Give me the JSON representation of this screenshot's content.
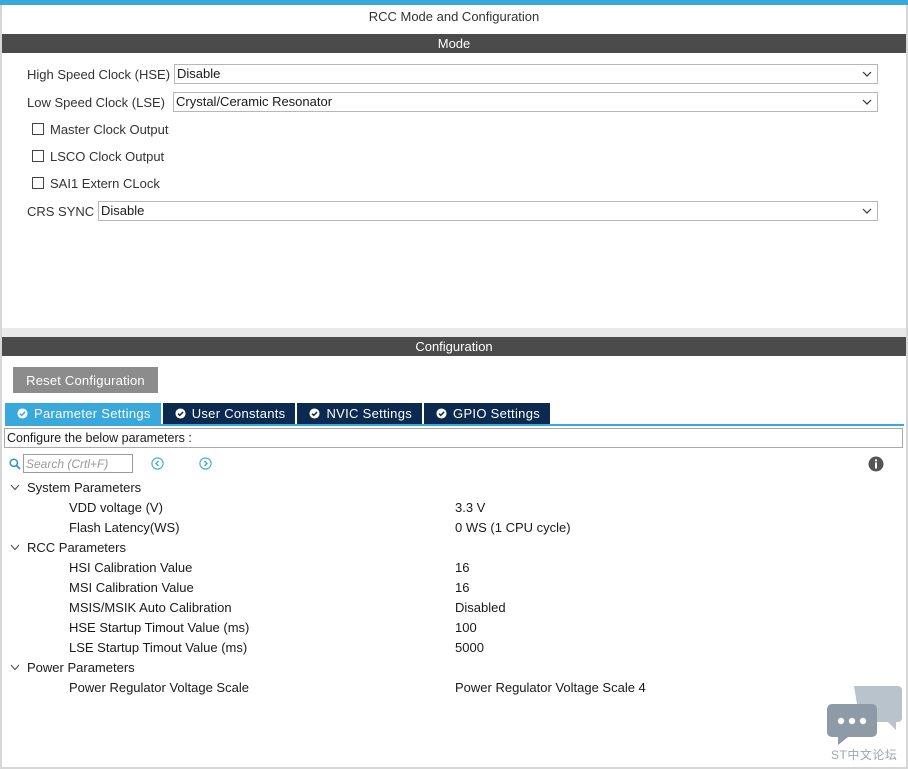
{
  "window": {
    "title": "RCC Mode and Configuration"
  },
  "mode": {
    "header": "Mode",
    "hse": {
      "label": "High Speed Clock (HSE)",
      "value": "Disable"
    },
    "lse": {
      "label": "Low Speed Clock (LSE)",
      "value": "Crystal/Ceramic Resonator"
    },
    "checkboxes": [
      {
        "label": "Master Clock Output",
        "checked": false
      },
      {
        "label": "LSCO Clock Output",
        "checked": false
      },
      {
        "label": "SAI1 Extern CLock",
        "checked": false
      }
    ],
    "crs": {
      "label": "CRS SYNC",
      "value": "Disable"
    }
  },
  "configuration": {
    "header": "Configuration",
    "reset_label": "Reset Configuration",
    "tabs": [
      {
        "label": "Parameter Settings",
        "active": true
      },
      {
        "label": "User Constants",
        "active": false
      },
      {
        "label": "NVIC Settings",
        "active": false
      },
      {
        "label": "GPIO Settings",
        "active": false
      }
    ],
    "describe": "Configure the below parameters :",
    "search": {
      "placeholder": "Search (Crtl+F)"
    },
    "groups": [
      {
        "name": "System Parameters",
        "params": [
          {
            "name": "VDD voltage (V)",
            "value": "3.3 V"
          },
          {
            "name": "Flash Latency(WS)",
            "value": "0 WS (1 CPU cycle)"
          }
        ]
      },
      {
        "name": "RCC Parameters",
        "params": [
          {
            "name": "HSI Calibration Value",
            "value": "16"
          },
          {
            "name": "MSI Calibration Value",
            "value": "16"
          },
          {
            "name": "MSIS/MSIK Auto Calibration",
            "value": "Disabled"
          },
          {
            "name": "HSE Startup Timout Value (ms)",
            "value": "100"
          },
          {
            "name": "LSE Startup Timout Value (ms)",
            "value": "5000"
          }
        ]
      },
      {
        "name": "Power Parameters",
        "params": [
          {
            "name": "Power Regulator Voltage Scale",
            "value": "Power Regulator Voltage Scale 4"
          }
        ]
      }
    ]
  },
  "watermark": {
    "text": "ST中文论坛"
  },
  "colors": {
    "accent": "#39a9dc",
    "tab_inactive": "#0c2a4f",
    "header_bg": "#4b4b4b",
    "button_bg": "#8c8c8c"
  },
  "icons": {
    "check": "check-circle-icon",
    "search": "search-icon",
    "prev": "chevron-left-circle-icon",
    "next": "chevron-right-circle-icon",
    "info": "info-icon",
    "dropdown": "chevron-down-icon",
    "expand": "chevron-down-icon",
    "chat": "chat-bubble-icon"
  }
}
